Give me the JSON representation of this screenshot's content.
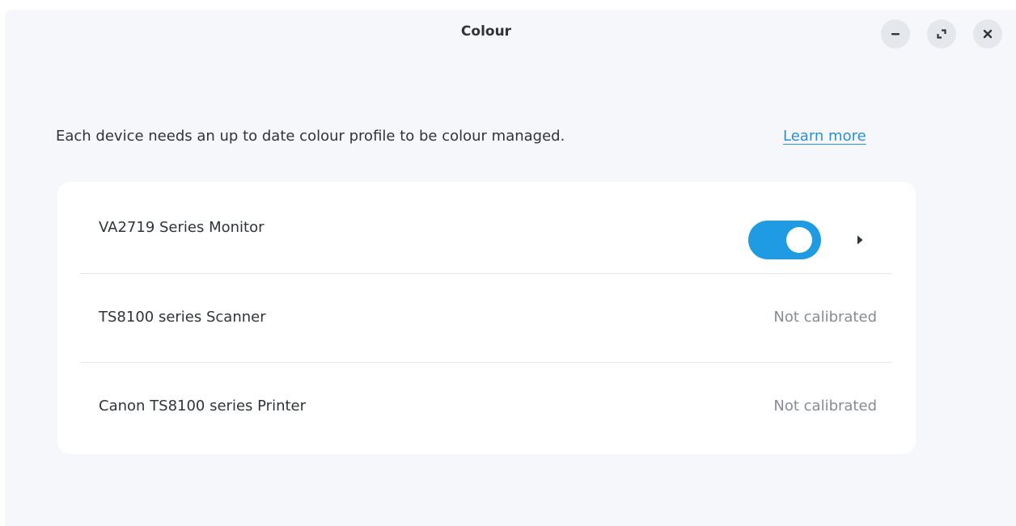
{
  "window": {
    "title": "Colour",
    "controls": {
      "minimize_icon": "minimize-icon",
      "maximize_icon": "maximize-icon",
      "close_icon": "close-icon"
    }
  },
  "main": {
    "description": "Each device needs an up to date colour profile to be colour managed.",
    "learn_more": "Learn more"
  },
  "devices": [
    {
      "name": "VA2719 Series Monitor",
      "toggle_on": true,
      "expand_icon": "chevron-right-icon"
    },
    {
      "name": "TS8100 series Scanner",
      "status": "Not calibrated"
    },
    {
      "name": "Canon TS8100 series Printer",
      "status": "Not calibrated"
    }
  ],
  "colors": {
    "accent": "#1e9be2",
    "link": "#2a8fd6",
    "background": "#f5f7fa",
    "card": "#ffffff",
    "muted_text": "#868c93"
  }
}
